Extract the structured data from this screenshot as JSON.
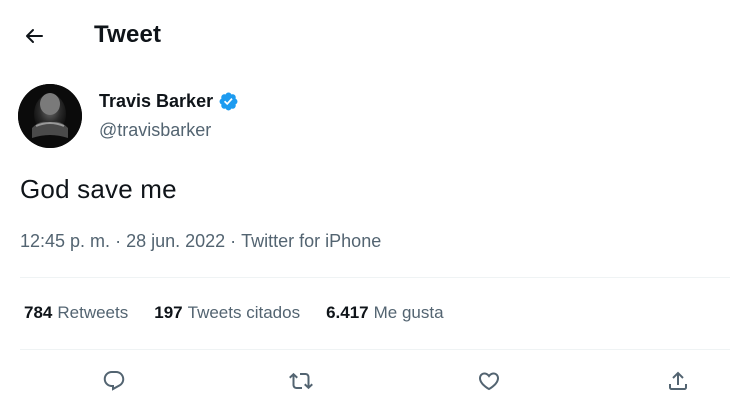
{
  "header": {
    "title": "Tweet",
    "back_icon": "arrow-left-icon"
  },
  "author": {
    "name": "Travis Barker",
    "handle": "@travisbarker",
    "verified_icon": "verified-badge-icon",
    "verified_color": "#1d9bf0"
  },
  "tweet": {
    "text": "God save me",
    "time": "12:45 p. m.",
    "date": "28 jun. 2022",
    "source": "Twitter for iPhone",
    "separator": " · "
  },
  "stats": [
    {
      "count": "784",
      "label": "Retweets"
    },
    {
      "count": "197",
      "label": "Tweets citados"
    },
    {
      "count": "6.417",
      "label": "Me gusta"
    }
  ],
  "actions": [
    {
      "icon": "reply-icon"
    },
    {
      "icon": "retweet-icon"
    },
    {
      "icon": "like-icon"
    },
    {
      "icon": "share-icon"
    }
  ],
  "colors": {
    "text": "#0f1419",
    "secondary": "#536471",
    "divider": "#eff3f4",
    "accent": "#1d9bf0"
  }
}
